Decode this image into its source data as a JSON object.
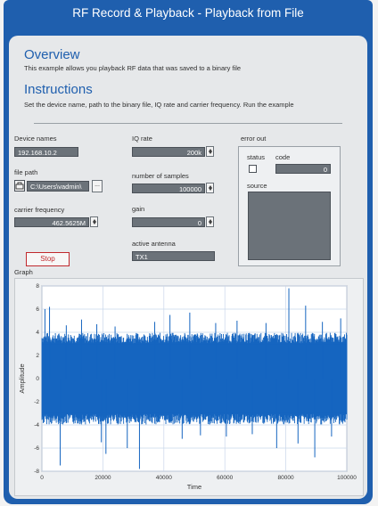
{
  "window": {
    "title": "RF Record & Playback - Playback from File"
  },
  "overview": {
    "heading": "Overview",
    "text": "This example allows you playback RF data that was saved to a binary file"
  },
  "instructions": {
    "heading": "Instructions",
    "text": "Set the device name, path to the binary file, IQ rate and carrier frequency. Run the example"
  },
  "controls": {
    "device_names": {
      "label": "Device names",
      "value": "192.168.10.2"
    },
    "iq_rate": {
      "label": "IQ rate",
      "value": "200k"
    },
    "file_path": {
      "label": "file path",
      "value": "C:\\Users\\vadmin\\",
      "browse": "..."
    },
    "number_of_samples": {
      "label": "number of samples",
      "value": "100000"
    },
    "carrier_frequency": {
      "label": "carrier frequency",
      "value": "462.5625M"
    },
    "gain": {
      "label": "gain",
      "value": "0"
    },
    "active_antenna": {
      "label": "active antenna",
      "value": "TX1"
    },
    "stop": {
      "label": "Stop"
    }
  },
  "error_out": {
    "label": "error out",
    "status_label": "status",
    "code_label": "code",
    "code_value": "0",
    "source_label": "source",
    "status_checked": false
  },
  "graph": {
    "label": "Graph"
  },
  "icons": {
    "file_path_icon": "folder-browse-icon"
  },
  "colors": {
    "title_bar": "#1f5fae",
    "panel": "#e6e8ea",
    "field": "#6b7279",
    "stop_red": "#c0282d",
    "signal": "#1565c0"
  },
  "chart_data": {
    "type": "line",
    "xlabel": "Time",
    "ylabel": "Amplitude",
    "xlim": [
      0,
      100000
    ],
    "ylim": [
      -8,
      8
    ],
    "x_ticks": [
      0,
      20000,
      40000,
      60000,
      80000,
      100000
    ],
    "y_ticks": [
      -8,
      -6,
      -4,
      -2,
      0,
      2,
      4,
      6,
      8
    ],
    "x_tick_labels": [
      "0",
      "20000",
      "40000",
      "60000",
      "80000",
      "100000"
    ],
    "y_tick_labels": [
      "-8",
      "-6",
      "-4",
      "-2",
      "0",
      "2",
      "4",
      "6",
      "8"
    ],
    "grid": true,
    "series": [
      {
        "envelope": [
          -3.6,
          3.6
        ],
        "peaks": [
          {
            "x": 1000,
            "y": 6.0
          },
          {
            "x": 2500,
            "y": 6.2
          },
          {
            "x": 6000,
            "y": -7.5
          },
          {
            "x": 8000,
            "y": 4.6
          },
          {
            "x": 13000,
            "y": 5.1
          },
          {
            "x": 18000,
            "y": 4.7
          },
          {
            "x": 19500,
            "y": -5.5
          },
          {
            "x": 21000,
            "y": -6.5
          },
          {
            "x": 24000,
            "y": 4.5
          },
          {
            "x": 28000,
            "y": -6.0
          },
          {
            "x": 32000,
            "y": -7.8
          },
          {
            "x": 37000,
            "y": 4.9
          },
          {
            "x": 42000,
            "y": 5.5
          },
          {
            "x": 46000,
            "y": -5.2
          },
          {
            "x": 48500,
            "y": 5.7
          },
          {
            "x": 52000,
            "y": -4.9
          },
          {
            "x": 57000,
            "y": 4.8
          },
          {
            "x": 60500,
            "y": -5.0
          },
          {
            "x": 64000,
            "y": 5.0
          },
          {
            "x": 69000,
            "y": -4.8
          },
          {
            "x": 73500,
            "y": 4.8
          },
          {
            "x": 77000,
            "y": -6.0
          },
          {
            "x": 81000,
            "y": 7.8
          },
          {
            "x": 84000,
            "y": -5.6
          },
          {
            "x": 86500,
            "y": 6.3
          },
          {
            "x": 89500,
            "y": -6.8
          },
          {
            "x": 92000,
            "y": 4.9
          },
          {
            "x": 95000,
            "y": -5.0
          },
          {
            "x": 98000,
            "y": 5.2
          }
        ]
      }
    ]
  }
}
